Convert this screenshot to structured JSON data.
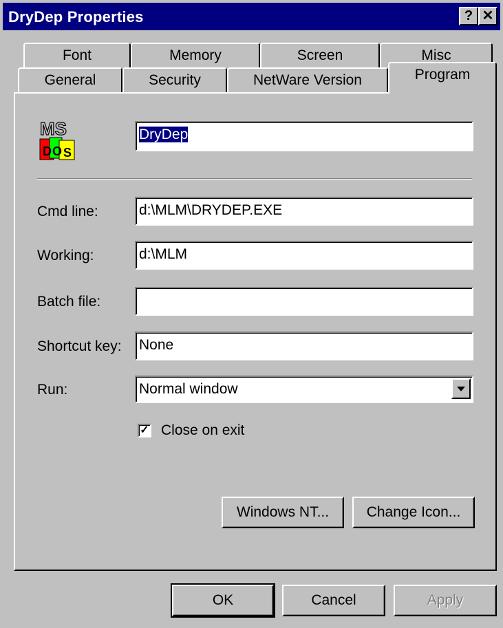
{
  "window": {
    "title": "DryDep Properties",
    "help_button": "?",
    "close_button": "✕"
  },
  "tabs": {
    "row1": [
      "Font",
      "Memory",
      "Screen",
      "Misc"
    ],
    "row2": [
      "General",
      "Security",
      "NetWare Version",
      "Program"
    ],
    "active": "Program"
  },
  "program": {
    "icon_label": "ms-dos-icon",
    "name_value": "DryDep",
    "cmd_line_label": "Cmd line:",
    "cmd_line_value": "d:\\MLM\\DRYDEP.EXE",
    "working_label": "Working:",
    "working_value": "d:\\MLM",
    "batch_label": "Batch file:",
    "batch_value": "",
    "shortcut_label": "Shortcut key:",
    "shortcut_value": "None",
    "run_label": "Run:",
    "run_value": "Normal window",
    "close_on_exit_label": "Close on exit",
    "close_on_exit_checked": true,
    "windows_nt_button": "Windows NT...",
    "change_icon_button": "Change Icon..."
  },
  "footer": {
    "ok": "OK",
    "cancel": "Cancel",
    "apply": "Apply"
  }
}
